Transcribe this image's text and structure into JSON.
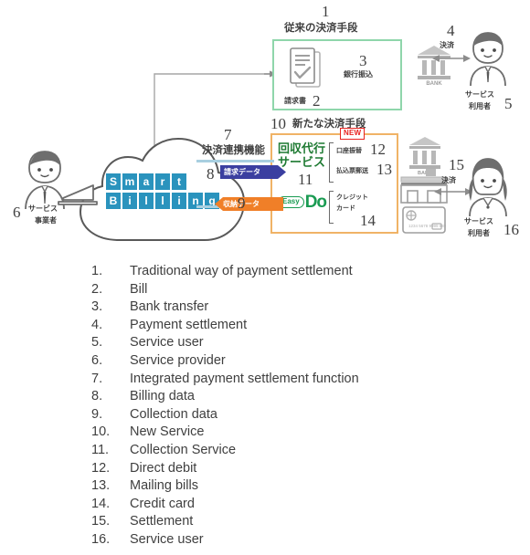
{
  "diagram": {
    "section_traditional": {
      "number": "1",
      "title_jp": "従来の決済手段",
      "bill_number": "2",
      "bill_label_jp": "請求書",
      "bank_transfer_number": "3",
      "bank_transfer_label_jp": "銀行振込",
      "box_border_color": "#8fd6ab"
    },
    "section_new": {
      "number": "10",
      "title_jp": "新たな決済手段",
      "box_border_color": "#f0b366",
      "collection_service": {
        "number": "11",
        "line1_jp": "回収代行",
        "line2_jp": "サービス",
        "color": "#1e7a32"
      },
      "new_badge": "NEW",
      "direct_debit": {
        "number": "12",
        "label_jp": "口座振替"
      },
      "mailing_bills": {
        "number": "13",
        "label_jp": "払込票郵送"
      },
      "credit_card": {
        "number": "14",
        "line1_jp": "クレジット",
        "line2_jp": "カード"
      },
      "easydo": {
        "easy_text": "Easy",
        "do_text": "Do",
        "color": "#1a9b52"
      }
    },
    "cloud": {
      "brand_line1": [
        "S",
        "m",
        "a",
        "r",
        "t"
      ],
      "brand_line2": [
        "B",
        "i",
        "l",
        "l",
        "i",
        "n",
        "g"
      ],
      "registered_mark": "®",
      "tile_color": "#2a93bd"
    },
    "integration": {
      "number": "7",
      "label_jp": "決済連携機能",
      "billing_data": {
        "number": "8",
        "label_jp": "請求データ",
        "color": "#3b3fa0",
        "direction": "right"
      },
      "collection_data": {
        "number": "9",
        "label_jp": "収納データ",
        "color": "#f07f28",
        "direction": "left"
      }
    },
    "service_provider": {
      "number": "6",
      "line1_jp": "サービス",
      "line2_jp": "事業者"
    },
    "settlement_top": {
      "number": "4",
      "label_jp": "決済",
      "bank_label": "BANK"
    },
    "service_user_top": {
      "number": "5",
      "line1_jp": "サービス",
      "line2_jp": "利用者"
    },
    "settlement_bottom": {
      "number": "15",
      "label_jp": "決済",
      "bank_label": "BANK"
    },
    "service_user_bottom": {
      "number": "16",
      "line1_jp": "サービス",
      "line2_jp": "利用者"
    }
  },
  "legend": {
    "items": [
      {
        "num": "1.",
        "text": "Traditional way of payment settlement"
      },
      {
        "num": "2.",
        "text": "Bill"
      },
      {
        "num": "3.",
        "text": "Bank transfer"
      },
      {
        "num": "4.",
        "text": "Payment settlement"
      },
      {
        "num": "5.",
        "text": "Service user"
      },
      {
        "num": "6.",
        "text": "Service provider"
      },
      {
        "num": "7.",
        "text": "Integrated payment settlement function"
      },
      {
        "num": "8.",
        "text": "Billing data"
      },
      {
        "num": "9.",
        "text": "Collection data"
      },
      {
        "num": "10.",
        "text": "New Service"
      },
      {
        "num": "11.",
        "text": "Collection Service"
      },
      {
        "num": "12.",
        "text": "Direct debit"
      },
      {
        "num": "13.",
        "text": "Mailing bills"
      },
      {
        "num": "14.",
        "text": "Credit card"
      },
      {
        "num": "15.",
        "text": "Settlement"
      },
      {
        "num": "16.",
        "text": "Service user"
      }
    ]
  }
}
